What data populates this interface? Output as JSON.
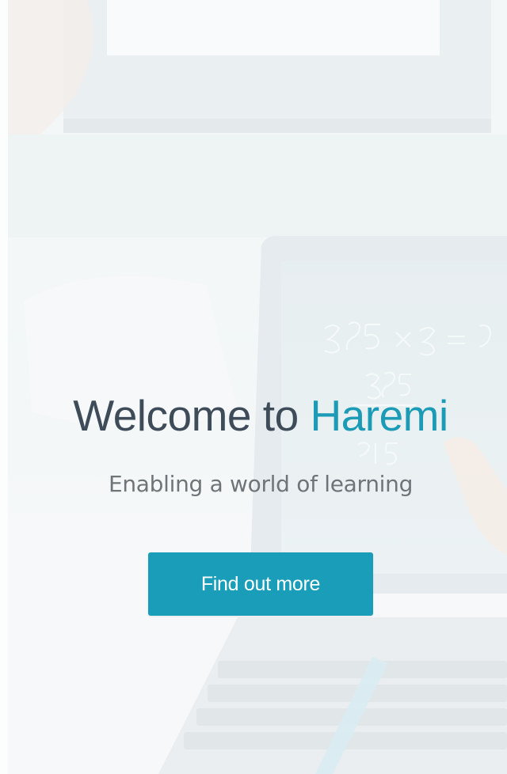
{
  "hero": {
    "title_prefix": "Welcome to ",
    "title_brand": "Haremi",
    "subtitle": "Enabling a world of learning",
    "cta_label": "Find out more"
  },
  "colors": {
    "title": "#3e4b59",
    "brand": "#1b9bb6",
    "subtitle": "#6f7478",
    "button_bg": "#1a9db8",
    "button_text": "#ffffff",
    "background": "#eef3f5"
  },
  "background_image": "faded photo of a child using a laptop showing handwritten math on a chalkboard-style screen"
}
